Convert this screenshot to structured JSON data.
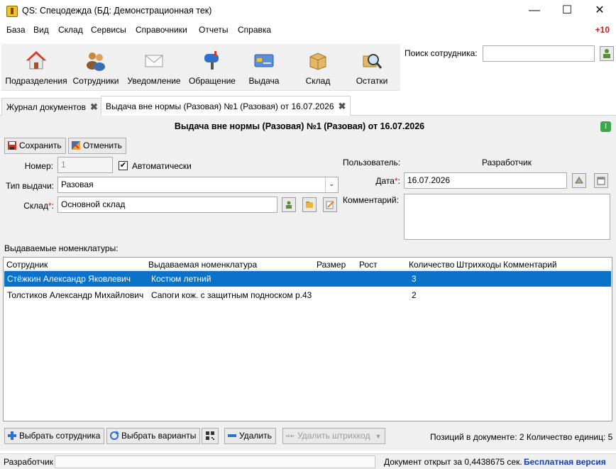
{
  "window": {
    "title": "QS: Спецодежда (БД: Демонстрационная тек)",
    "minimize": "—",
    "maximize": "☐",
    "close": "✕"
  },
  "menu": {
    "items": [
      "База",
      "Вид",
      "Склад",
      "Сервисы",
      "Справочники",
      "Отчеты",
      "Справка"
    ],
    "badge": "+10"
  },
  "toolbar": {
    "items": [
      {
        "label": "Подразделения",
        "icon": "house-icon"
      },
      {
        "label": "Сотрудники",
        "icon": "people-icon"
      },
      {
        "label": "Уведомление",
        "icon": "envelope-icon"
      },
      {
        "label": "Обращение",
        "icon": "mailbox-icon"
      },
      {
        "label": "Выдача",
        "icon": "card-icon"
      },
      {
        "label": "Склад",
        "icon": "box-icon"
      },
      {
        "label": "Остатки",
        "icon": "magnifier-icon"
      }
    ]
  },
  "search": {
    "label": "Поиск сотрудника:",
    "value": ""
  },
  "tabs": [
    {
      "label": "Журнал документов",
      "active": false
    },
    {
      "label": "Выдача вне нормы (Разовая) №1 (Разовая) от 16.07.2026",
      "active": true
    }
  ],
  "document": {
    "title": "Выдача вне нормы (Разовая) №1 (Разовая) от 16.07.2026",
    "save_label": "Сохранить",
    "cancel_label": "Отменить",
    "number_label": "Номер:",
    "number_value": "1",
    "auto_label": "Автоматически",
    "auto_checked": true,
    "issue_type_label": "Тип выдачи:",
    "issue_type_value": "Разовая",
    "warehouse_label": "Склад",
    "warehouse_value": "Основной склад",
    "user_label": "Пользователь:",
    "user_value": "Разработчик",
    "date_label": "Дата",
    "date_value": "16.07.2026",
    "comment_label": "Комментарий:",
    "comment_value": ""
  },
  "grid": {
    "label": "Выдаваемые номенклатуры:",
    "columns": [
      "Сотрудник",
      "Выдаваемая номенклатура",
      "Размер",
      "Рост",
      "Количество",
      "Штрихкоды",
      "Комментарий"
    ],
    "rows": [
      {
        "employee": "Стёжкин Александр Яковлевич",
        "item": "Костюм летний",
        "size": "",
        "height": "",
        "qty": "3",
        "barcodes": "",
        "comment": "",
        "selected": true
      },
      {
        "employee": "Толстиков Александр Михайлович",
        "item": "Сапоги кож. с защитным подноском р.43",
        "size": "",
        "height": "",
        "qty": "2",
        "barcodes": "",
        "comment": "",
        "selected": false
      }
    ]
  },
  "bottom": {
    "select_employee_label": "Выбрать сотрудника",
    "select_variants_label": "Выбрать варианты",
    "delete_label": "Удалить",
    "delete_barcode_label": "Удалить штрихкод",
    "positions_info": "Позиций в документе: 2  Количество единиц: 5"
  },
  "statusbar": {
    "user": "Разработчик",
    "open_time": "Документ открыт за 0,4438675 сек.",
    "version": "Бесплатная версия"
  }
}
